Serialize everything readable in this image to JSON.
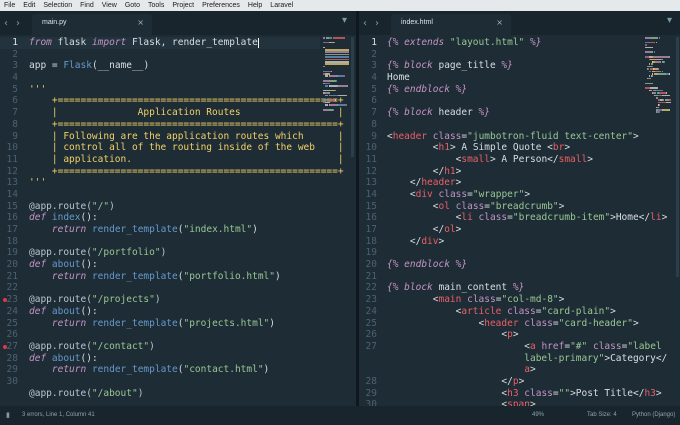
{
  "menu": [
    "File",
    "Edit",
    "Selection",
    "Find",
    "View",
    "Goto",
    "Tools",
    "Project",
    "Preferences",
    "Help",
    "Laravel"
  ],
  "left_tab": {
    "label": "main.py",
    "close": "×"
  },
  "right_tab": {
    "label": "index.html",
    "close": "×"
  },
  "icons": {
    "back": "‹",
    "forward": "›",
    "tab_menu": "▾"
  },
  "colors": {
    "keyword": "#c594c5",
    "function": "#6699cc",
    "string": "#99c794",
    "comment": "#f3d067",
    "tag": "#ec5f67",
    "error_dot": "#e0384d",
    "background": "#1d2c35"
  },
  "left_code": {
    "line_numbers": [
      "1",
      "2",
      "3",
      "4",
      "5",
      "6",
      "7",
      "8",
      "9",
      "10",
      "11",
      "12",
      "13",
      "14",
      "15",
      "16",
      "17",
      "18",
      "19",
      "20",
      "21",
      "22",
      "23",
      "24",
      "25",
      "26",
      "27",
      "28",
      "29",
      "30"
    ],
    "error_lines": [
      "23",
      "27"
    ],
    "lines": [
      [
        [
          "kw",
          "from"
        ],
        [
          "txt",
          " flask "
        ],
        [
          "kw",
          "import"
        ],
        [
          "txt",
          " Flask, render_template"
        ]
      ],
      [],
      [
        [
          "txt",
          "app = "
        ],
        [
          "fn",
          "Flask"
        ],
        [
          "txt",
          "("
        ],
        [
          "txt",
          "__name__"
        ],
        [
          "txt",
          ")"
        ]
      ],
      [],
      [
        [
          "cmt",
          "'''"
        ]
      ],
      [
        [
          "cmt",
          "    +=================================================+"
        ]
      ],
      [
        [
          "cmt",
          "    |              Application Routes                 |"
        ]
      ],
      [
        [
          "cmt",
          "    +=================================================+"
        ]
      ],
      [
        [
          "cmt",
          "    | Following are the application routes which      |"
        ]
      ],
      [
        [
          "cmt",
          "    | control all of the routing inside of the web    |"
        ]
      ],
      [
        [
          "cmt",
          "    | application.                                    |"
        ]
      ],
      [
        [
          "cmt",
          "    +=================================================+"
        ]
      ],
      [
        [
          "cmt",
          "'''"
        ]
      ],
      [],
      [
        [
          "deco",
          "@app.route("
        ],
        [
          "str",
          "\"/\""
        ],
        [
          "deco",
          ")"
        ]
      ],
      [
        [
          "kw",
          "def"
        ],
        [
          "fn",
          " index"
        ],
        [
          "txt",
          "():"
        ]
      ],
      [
        [
          "kw",
          "    return"
        ],
        [
          "txt",
          " "
        ],
        [
          "fn",
          "render_template"
        ],
        [
          "txt",
          "("
        ],
        [
          "str",
          "\"index.html\""
        ],
        [
          "txt",
          ")"
        ]
      ],
      [],
      [
        [
          "deco",
          "@app.route("
        ],
        [
          "str",
          "\"/portfolio\""
        ],
        [
          "deco",
          ")"
        ]
      ],
      [
        [
          "kw",
          "def"
        ],
        [
          "fn",
          " about"
        ],
        [
          "txt",
          "():"
        ]
      ],
      [
        [
          "kw",
          "    return"
        ],
        [
          "txt",
          " "
        ],
        [
          "fn",
          "render_template"
        ],
        [
          "txt",
          "("
        ],
        [
          "str",
          "\"portfolio.html\""
        ],
        [
          "txt",
          ")"
        ]
      ],
      [],
      [
        [
          "deco",
          "@app.route("
        ],
        [
          "str",
          "\"/projects\""
        ],
        [
          "deco",
          ")"
        ]
      ],
      [
        [
          "kw",
          "def"
        ],
        [
          "fn",
          " about"
        ],
        [
          "txt",
          "():"
        ]
      ],
      [
        [
          "kw",
          "    return"
        ],
        [
          "txt",
          " "
        ],
        [
          "fn",
          "render_template"
        ],
        [
          "txt",
          "("
        ],
        [
          "str",
          "\"projects.html\""
        ],
        [
          "txt",
          ")"
        ]
      ],
      [],
      [
        [
          "deco",
          "@app.route("
        ],
        [
          "str",
          "\"/contact\""
        ],
        [
          "deco",
          ")"
        ]
      ],
      [
        [
          "kw",
          "def"
        ],
        [
          "fn",
          " about"
        ],
        [
          "txt",
          "():"
        ]
      ],
      [
        [
          "kw",
          "    return"
        ],
        [
          "txt",
          " "
        ],
        [
          "fn",
          "render_template"
        ],
        [
          "txt",
          "("
        ],
        [
          "str",
          "\"contact.html\""
        ],
        [
          "txt",
          ")"
        ]
      ],
      [],
      [
        [
          "deco",
          "@app.route("
        ],
        [
          "str",
          "\"/about\""
        ],
        [
          "deco",
          ")"
        ]
      ]
    ]
  },
  "right_code": {
    "line_numbers": [
      "1",
      "2",
      "3",
      "4",
      "5",
      "6",
      "7",
      "8",
      "9",
      "10",
      "11",
      "12",
      "13",
      "14",
      "15",
      "16",
      "17",
      "18",
      "19",
      "20",
      "21",
      "22",
      "23",
      "24",
      "25",
      "26",
      "27",
      "",
      "",
      "28",
      "29",
      "30"
    ],
    "lines": [
      [
        [
          "blk",
          "{% extends "
        ],
        [
          "str",
          "\"layout.html\""
        ],
        [
          "blk",
          " %}"
        ]
      ],
      [],
      [
        [
          "blk",
          "{% block "
        ],
        [
          "txt",
          "page_title"
        ],
        [
          "blk",
          " %}"
        ]
      ],
      [
        [
          "txt",
          "Home"
        ]
      ],
      [
        [
          "blk",
          "{% endblock %}"
        ]
      ],
      [],
      [
        [
          "blk",
          "{% block "
        ],
        [
          "txt",
          "header"
        ],
        [
          "blk",
          " %}"
        ]
      ],
      [],
      [
        [
          "txt",
          "<"
        ],
        [
          "tag",
          "header"
        ],
        [
          "attr",
          " class"
        ],
        [
          "txt",
          "="
        ],
        [
          "str",
          "\"jumbotron-fluid text-center\""
        ],
        [
          "txt",
          ">"
        ]
      ],
      [
        [
          "txt",
          "        <"
        ],
        [
          "tag",
          "h1"
        ],
        [
          "txt",
          "> A Simple Quote <"
        ],
        [
          "tag",
          "br"
        ],
        [
          "txt",
          ">"
        ]
      ],
      [
        [
          "txt",
          "            <"
        ],
        [
          "tag",
          "small"
        ],
        [
          "txt",
          "> A Person</"
        ],
        [
          "tag",
          "small"
        ],
        [
          "txt",
          ">"
        ]
      ],
      [
        [
          "txt",
          "        </"
        ],
        [
          "tag",
          "h1"
        ],
        [
          "txt",
          ">"
        ]
      ],
      [
        [
          "txt",
          "    </"
        ],
        [
          "tag",
          "header"
        ],
        [
          "txt",
          ">"
        ]
      ],
      [
        [
          "txt",
          "    <"
        ],
        [
          "tag",
          "div"
        ],
        [
          "attr",
          " class"
        ],
        [
          "txt",
          "="
        ],
        [
          "str",
          "\"wrapper\""
        ],
        [
          "txt",
          ">"
        ]
      ],
      [
        [
          "txt",
          "        <"
        ],
        [
          "tag",
          "ol"
        ],
        [
          "attr",
          " class"
        ],
        [
          "txt",
          "="
        ],
        [
          "str",
          "\"breadcrumb\""
        ],
        [
          "txt",
          ">"
        ]
      ],
      [
        [
          "txt",
          "            <"
        ],
        [
          "tag",
          "li"
        ],
        [
          "attr",
          " class"
        ],
        [
          "txt",
          "="
        ],
        [
          "str",
          "\"breadcrumb-item\""
        ],
        [
          "txt",
          ">Home</"
        ],
        [
          "tag",
          "li"
        ],
        [
          "txt",
          ">"
        ]
      ],
      [
        [
          "txt",
          "        </"
        ],
        [
          "tag",
          "ol"
        ],
        [
          "txt",
          ">"
        ]
      ],
      [
        [
          "txt",
          "    </"
        ],
        [
          "tag",
          "div"
        ],
        [
          "txt",
          ">"
        ]
      ],
      [],
      [
        [
          "blk",
          "{% endblock %}"
        ]
      ],
      [],
      [
        [
          "blk",
          "{% block "
        ],
        [
          "txt",
          "main_content"
        ],
        [
          "blk",
          " %}"
        ]
      ],
      [
        [
          "txt",
          "        <"
        ],
        [
          "tag",
          "main"
        ],
        [
          "attr",
          " class"
        ],
        [
          "txt",
          "="
        ],
        [
          "str",
          "\"col-md-8\""
        ],
        [
          "txt",
          ">"
        ]
      ],
      [
        [
          "txt",
          "            <"
        ],
        [
          "tag",
          "article"
        ],
        [
          "attr",
          " class"
        ],
        [
          "txt",
          "="
        ],
        [
          "str",
          "\"card-plain\""
        ],
        [
          "txt",
          ">"
        ]
      ],
      [
        [
          "txt",
          "                <"
        ],
        [
          "tag",
          "header"
        ],
        [
          "attr",
          " class"
        ],
        [
          "txt",
          "="
        ],
        [
          "str",
          "\"card-header\""
        ],
        [
          "txt",
          ">"
        ]
      ],
      [
        [
          "txt",
          "                    <"
        ],
        [
          "tag",
          "p"
        ],
        [
          "txt",
          ">"
        ]
      ],
      [
        [
          "txt",
          "                        <"
        ],
        [
          "tag",
          "a"
        ],
        [
          "attr",
          " href"
        ],
        [
          "txt",
          "="
        ],
        [
          "str",
          "\"#\""
        ],
        [
          "attr",
          " class"
        ],
        [
          "txt",
          "="
        ],
        [
          "str",
          "\"label"
        ]
      ],
      [
        [
          "str",
          "                        label-primary\""
        ],
        [
          "txt",
          ">Category</"
        ]
      ],
      [
        [
          "txt",
          "                        "
        ],
        [
          "tag",
          "a"
        ],
        [
          "txt",
          ">"
        ]
      ],
      [
        [
          "txt",
          "                    </"
        ],
        [
          "tag",
          "p"
        ],
        [
          "txt",
          ">"
        ]
      ],
      [
        [
          "txt",
          "                    <"
        ],
        [
          "tag",
          "h3"
        ],
        [
          "attr",
          " class"
        ],
        [
          "txt",
          "="
        ],
        [
          "str",
          "\"\""
        ],
        [
          "txt",
          ">Post Title</"
        ],
        [
          "tag",
          "h3"
        ],
        [
          "txt",
          ">"
        ]
      ],
      [
        [
          "txt",
          "                    <"
        ],
        [
          "tag",
          "span"
        ],
        [
          "txt",
          ">"
        ]
      ]
    ]
  },
  "status": {
    "errors": "3 errors, Line 1, Column 41",
    "zoom": "49%",
    "tab_size": "Tab Size: 4",
    "syntax": "Python (Django)"
  }
}
